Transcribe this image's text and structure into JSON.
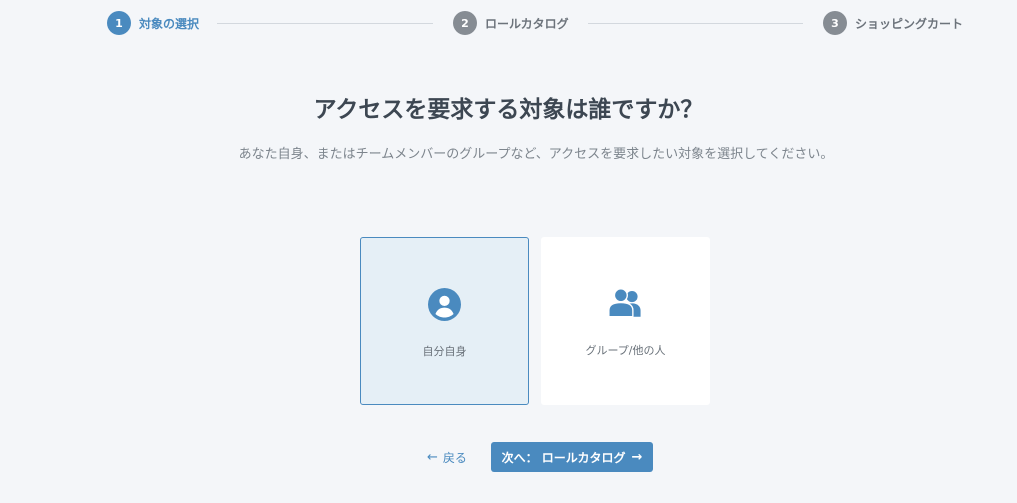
{
  "stepper": {
    "steps": [
      {
        "number": "1",
        "label": "対象の選択",
        "state": "active"
      },
      {
        "number": "2",
        "label": "ロールカタログ",
        "state": "inactive"
      },
      {
        "number": "3",
        "label": "ショッピングカート",
        "state": "inactive"
      }
    ]
  },
  "main": {
    "title": "アクセスを要求する対象は誰ですか？",
    "subtitle": "あなた自身、またはチームメンバーのグループなど、アクセスを要求したい対象を選択してください。",
    "options": [
      {
        "label": "自分自身",
        "icon": "user-circle-icon",
        "selected": true
      },
      {
        "label": "グループ/他の人",
        "icon": "users-group-icon",
        "selected": false
      }
    ]
  },
  "actions": {
    "back_label": "戻る",
    "back_icon": "arrow-left-icon",
    "next_label": "次へ： ロールカタログ",
    "next_icon": "arrow-right-icon"
  },
  "colors": {
    "accent": "#4a8abf",
    "inactive_step": "#868c93",
    "background": "#f4f6f9",
    "selected_card_bg": "#e5eff6"
  }
}
